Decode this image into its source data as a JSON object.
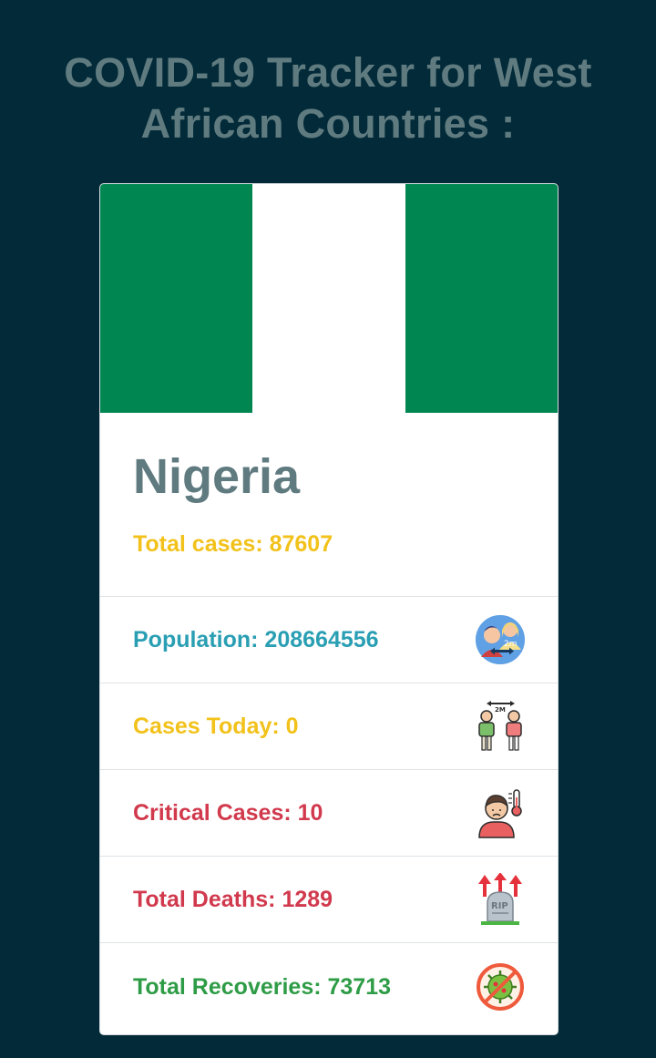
{
  "header": {
    "title": "COVID-19 Tracker for West African Countries :"
  },
  "country": {
    "name": "Nigeria",
    "total_cases_label": "Total cases: 87607",
    "flag": {
      "bands": [
        "#008751",
        "#ffffff",
        "#008751"
      ]
    }
  },
  "stats": [
    {
      "label": "Population: 208664556",
      "color": "#2a9fb4",
      "icon": "social-distance-people-icon"
    },
    {
      "label": "Cases Today: 0",
      "color": "#f2c21b",
      "icon": "people-distance-icon"
    },
    {
      "label": "Critical Cases: 10",
      "color": "#d1394d",
      "icon": "sick-person-thermometer-icon"
    },
    {
      "label": "Total Deaths: 1289",
      "color": "#d1394d",
      "icon": "rip-gravestone-icon"
    },
    {
      "label": "Total Recoveries: 73713",
      "color": "#2e9c46",
      "icon": "no-virus-icon"
    }
  ],
  "colors": {
    "background": "#022a38",
    "title": "#5f7b80",
    "total_cases": "#f2c21b"
  }
}
